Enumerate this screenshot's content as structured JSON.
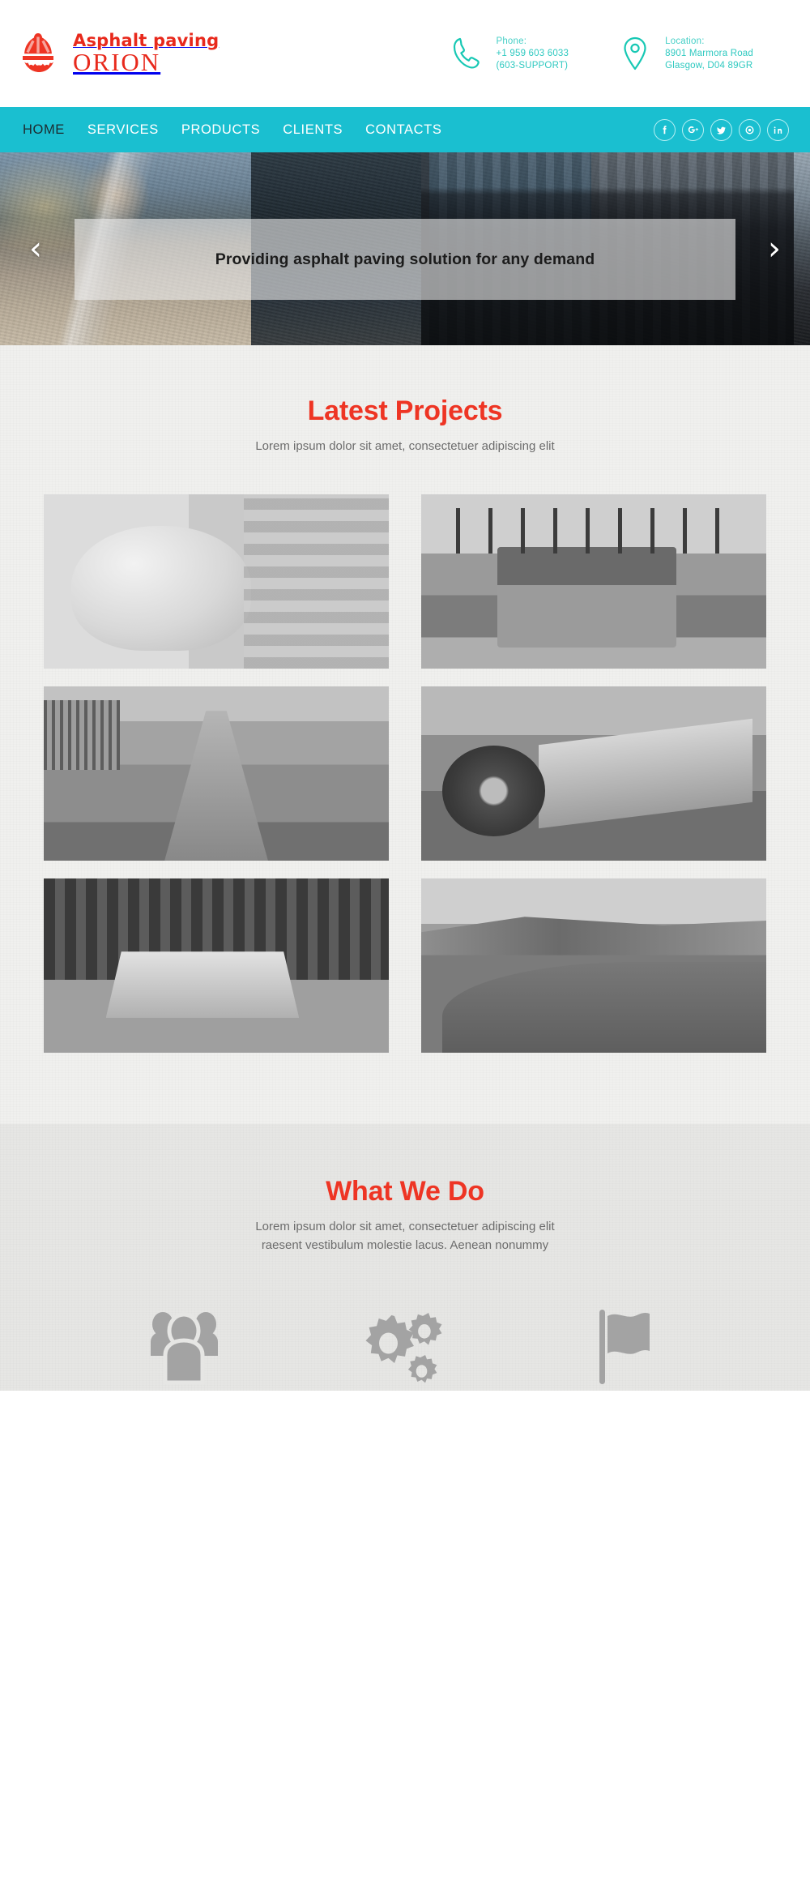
{
  "header": {
    "logo_icon": "hardhat-gear-icon",
    "brand_tagline": "Asphalt paving",
    "brand_name": "ORION",
    "accent_red": "#ee3524",
    "accent_teal": "#1abfd0",
    "contacts": [
      {
        "icon": "phone-icon",
        "label": "Phone:",
        "line1": "+1 959 603 6033",
        "line2": "(603-SUPPORT)"
      },
      {
        "icon": "location-pin-icon",
        "label": "Location:",
        "line1": "8901 Marmora Road",
        "line2": "Glasgow, D04 89GR"
      }
    ]
  },
  "nav": {
    "items": [
      {
        "label": "HOME",
        "active": true
      },
      {
        "label": "SERVICES",
        "active": false
      },
      {
        "label": "PRODUCTS",
        "active": false
      },
      {
        "label": "CLIENTS",
        "active": false
      },
      {
        "label": "CONTACTS",
        "active": false
      }
    ],
    "social": [
      {
        "name": "facebook-icon",
        "glyph": "f"
      },
      {
        "name": "google-plus-icon",
        "glyph": "g+"
      },
      {
        "name": "twitter-icon",
        "glyph": "t"
      },
      {
        "name": "pinterest-icon",
        "glyph": "p"
      },
      {
        "name": "linkedin-icon",
        "glyph": "in"
      }
    ]
  },
  "hero": {
    "caption": "Providing asphalt paving solution for any demand",
    "prev_arrow": "‹",
    "next_arrow": "›"
  },
  "projects": {
    "title": "Latest Projects",
    "subtitle": "Lorem ipsum dolor sit amet, consectetuer adipiscing elit",
    "tiles": [
      {
        "name": "project-thumb-hardhat",
        "art": "ph-helmet"
      },
      {
        "name": "project-thumb-road-roller",
        "art": "ph-roller"
      },
      {
        "name": "project-thumb-road-construction",
        "art": "ph-road"
      },
      {
        "name": "project-thumb-loader-bucket",
        "art": "ph-loader"
      },
      {
        "name": "project-thumb-concrete-barrier",
        "art": "ph-barrier"
      },
      {
        "name": "project-thumb-mountain-highway",
        "art": "ph-highway"
      }
    ]
  },
  "what_we_do": {
    "title": "What We Do",
    "subtitle_line1": "Lorem ipsum dolor sit amet, consectetuer adipiscing elit",
    "subtitle_line2": "raesent vestibulum molestie lacus. Aenean nonummy",
    "icons": [
      {
        "name": "people-group-icon"
      },
      {
        "name": "gears-icon"
      },
      {
        "name": "flag-icon"
      }
    ]
  }
}
